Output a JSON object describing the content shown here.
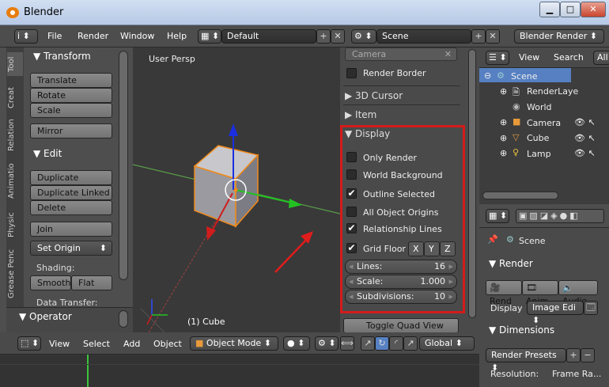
{
  "window": {
    "title": "Blender",
    "controls": [
      "▁",
      "□",
      "✕"
    ]
  },
  "menubar": {
    "info_icon": "i",
    "file": "File",
    "render": "Render",
    "window": "Window",
    "help": "Help",
    "layout": "Default",
    "scene": "Scene",
    "engine": "Blender Render"
  },
  "toolshelf": {
    "tabs": [
      "Tool",
      "Creat",
      "Relation",
      "Animatio",
      "Physic",
      "Grease Penc"
    ],
    "transform_header": "▼ Transform",
    "translate": "Translate",
    "rotate": "Rotate",
    "scale": "Scale",
    "mirror": "Mirror",
    "edit_header": "▼ Edit",
    "duplicate": "Duplicate",
    "duplicate_linked": "Duplicate Linked",
    "delete": "Delete",
    "join": "Join",
    "set_origin": "Set Origin",
    "shading_label": "Shading:",
    "smooth": "Smooth",
    "flat": "Flat",
    "data_transfer": "Data Transfer:",
    "operator_header": "▼ Operator"
  },
  "viewport": {
    "label": "User Persp",
    "object_label": "(1) Cube"
  },
  "npanel": {
    "camera": "Camera",
    "render_border": "Render Border",
    "cursor_header": "▶ 3D Cursor",
    "item_header": "▶ Item",
    "display_header": "▼ Display",
    "only_render": "Only Render",
    "world_background": "World Background",
    "outline_selected": "Outline Selected",
    "all_object_origins": "All Object Origins",
    "relationship_lines": "Relationship Lines",
    "grid_floor": "Grid Floor",
    "x": "X",
    "y": "Y",
    "z": "Z",
    "lines_label": "Lines:",
    "lines_value": "16",
    "scale_label": "Scale:",
    "scale_value": "1.000",
    "subdiv_label": "Subdivisions:",
    "subdiv_value": "10",
    "toggle_quad": "Toggle Quad View",
    "checkboxes": {
      "only_render": false,
      "world_background": false,
      "outline_selected": true,
      "all_object_origins": false,
      "relationship_lines": true,
      "grid_floor": true
    }
  },
  "outliner": {
    "view": "View",
    "search": "Search",
    "all": "All",
    "scene": "Scene",
    "render_layers": "RenderLaye",
    "world": "World",
    "camera": "Camera",
    "cube": "Cube",
    "lamp": "Lamp"
  },
  "properties": {
    "scene": "Scene",
    "render_header": "▼ Render",
    "rend": "Rend",
    "anim": "Anim",
    "audio": "Audio",
    "display_label": "Display",
    "display_value": "Image Edi",
    "dimensions_header": "▼ Dimensions",
    "render_presets": "Render Presets",
    "resolution_label": "Resolution:",
    "frame_range": "Frame Ra..."
  },
  "viewheader": {
    "view": "View",
    "select": "Select",
    "add": "Add",
    "object": "Object",
    "mode": "Object Mode",
    "pivot": "Global"
  },
  "colors": {
    "highlight": "#d41b1b",
    "accent": "#e87d0d",
    "selection": "#5680c2"
  }
}
